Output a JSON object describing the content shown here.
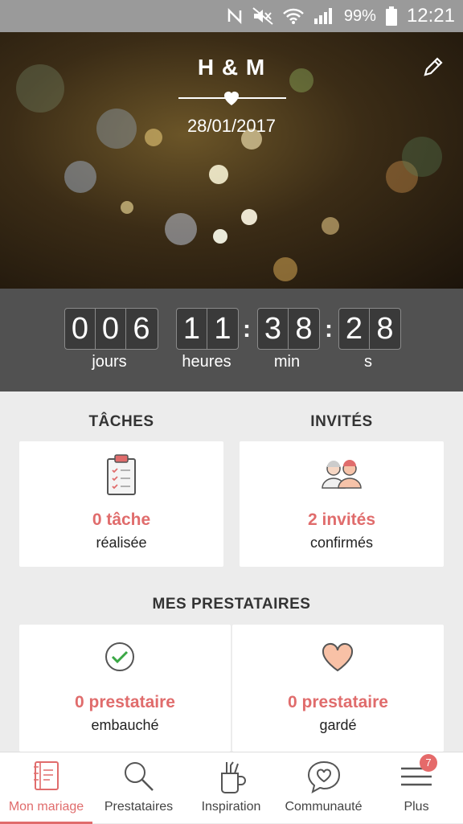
{
  "status_bar": {
    "battery": "99%",
    "time": "12:21"
  },
  "hero": {
    "couple": "H & M",
    "date": "28/01/2017"
  },
  "countdown": {
    "days": [
      "0",
      "0",
      "6"
    ],
    "hours": [
      "1",
      "1"
    ],
    "minutes": [
      "3",
      "8"
    ],
    "seconds": [
      "2",
      "8"
    ],
    "labels": {
      "days": "jours",
      "hours": "heures",
      "minutes": "min",
      "seconds": "s"
    }
  },
  "tasks": {
    "title": "TÂCHES",
    "value": "0 tâche",
    "sub": "réalisée"
  },
  "guests": {
    "title": "INVITÉS",
    "value": "2 invités",
    "sub": "confirmés"
  },
  "vendors": {
    "title": "MES PRESTATAIRES",
    "hired": {
      "value": "0 prestataire",
      "sub": "embauché"
    },
    "saved": {
      "value": "0 prestataire",
      "sub": "gardé"
    }
  },
  "nav": {
    "items": [
      {
        "label": "Mon mariage",
        "icon": "notebook-icon"
      },
      {
        "label": "Prestataires",
        "icon": "search-icon"
      },
      {
        "label": "Inspiration",
        "icon": "brush-cup-icon"
      },
      {
        "label": "Communauté",
        "icon": "chat-heart-icon"
      },
      {
        "label": "Plus",
        "icon": "menu-icon"
      }
    ],
    "badge": "7"
  },
  "colors": {
    "accent": "#e06c6c",
    "countdown_bg": "#515151",
    "statusbar_bg": "#9a9a9a"
  }
}
